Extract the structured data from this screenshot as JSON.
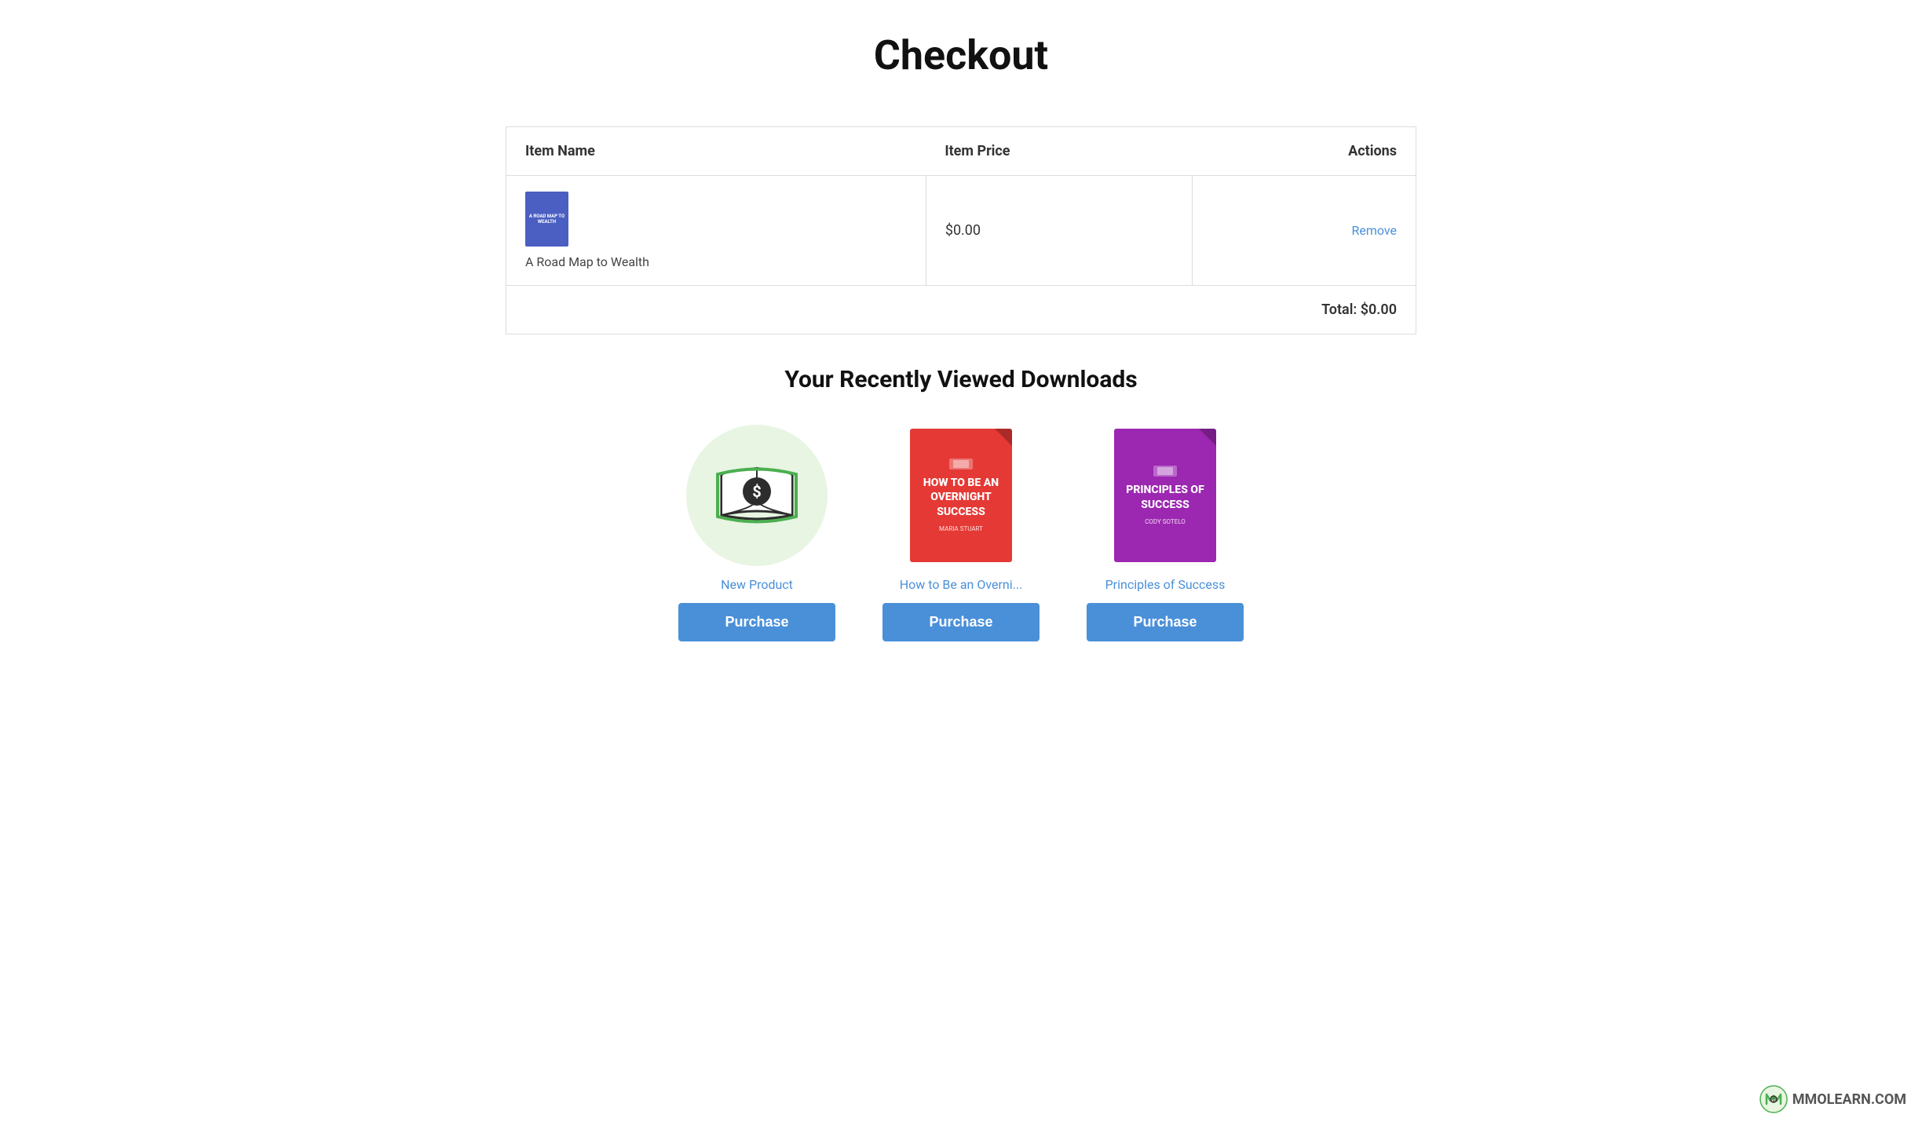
{
  "page": {
    "title": "Checkout"
  },
  "table": {
    "headers": {
      "item_name": "Item Name",
      "item_price": "Item Price",
      "actions": "Actions"
    },
    "rows": [
      {
        "id": "row-1",
        "name": "A Road Map to Wealth",
        "price": "$0.00",
        "action_label": "Remove"
      }
    ],
    "total_label": "Total: $0.00"
  },
  "recently_viewed": {
    "section_title": "Your Recently Viewed Downloads",
    "products": [
      {
        "id": "product-1",
        "name": "New Product",
        "type": "book-icon",
        "purchase_label": "Purchase"
      },
      {
        "id": "product-2",
        "name": "How to Be an Overni...",
        "type": "book-cover-red",
        "title_text": "HOW TO BE AN OVERNIGHT SUCCESS",
        "author": "MARIA STUART",
        "purchase_label": "Purchase"
      },
      {
        "id": "product-3",
        "name": "Principles of Success",
        "type": "book-cover-purple",
        "title_text": "PRINCIPLES OF SUCCESS",
        "author": "CODY SOTELO",
        "purchase_label": "Purchase"
      }
    ]
  },
  "logo": {
    "text": "MMOLEARN.COM"
  }
}
